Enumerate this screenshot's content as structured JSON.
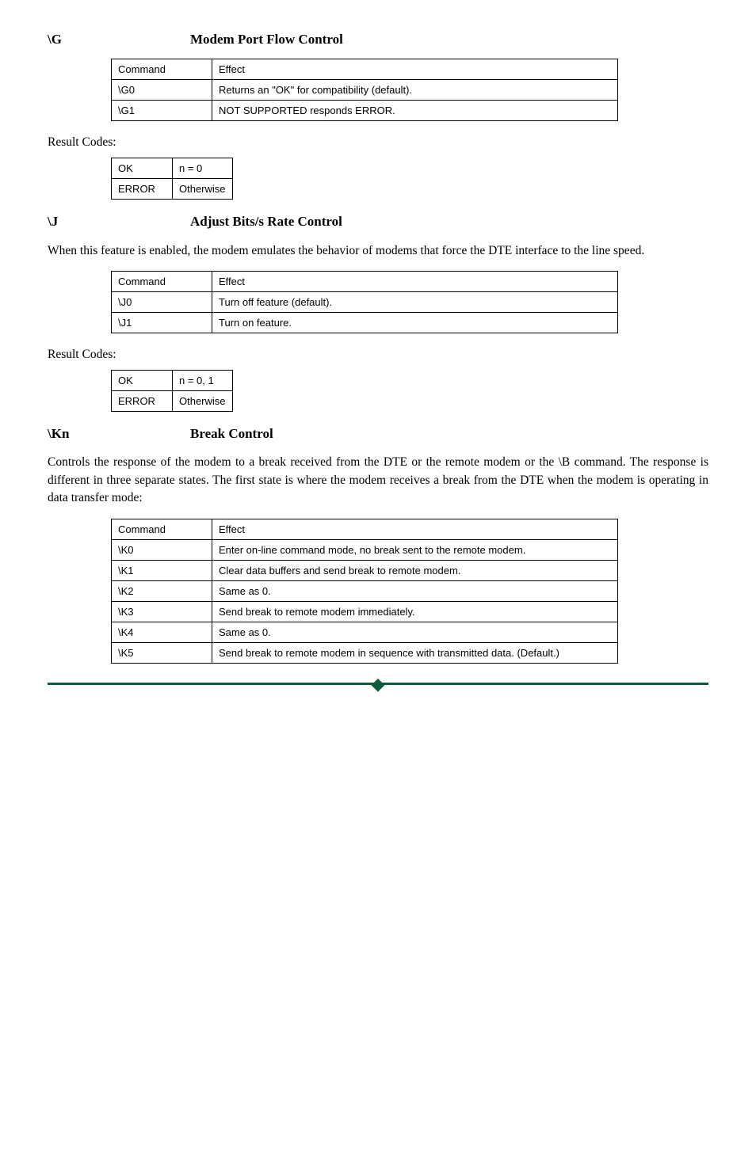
{
  "sections": {
    "g": {
      "key": "\\G",
      "title": "Modem Port Flow Control",
      "effect_header": {
        "command": "Command",
        "effect": "Effect"
      },
      "effects": [
        {
          "cmd": "\\G0",
          "eff": "Returns an \"OK\" for compatibility (default)."
        },
        {
          "cmd": "\\G1",
          "eff": "NOT SUPPORTED responds ERROR."
        }
      ],
      "result_label": "Result Codes:",
      "results": [
        {
          "code": "OK",
          "cond": "n = 0"
        },
        {
          "code": "ERROR",
          "cond": "Otherwise"
        }
      ]
    },
    "j": {
      "key": "\\J",
      "title": "Adjust Bits/s Rate Control",
      "body": "When this feature is enabled, the modem emulates the behavior of modems that force the DTE interface to the line speed.",
      "effect_header": {
        "command": "Command",
        "effect": "Effect"
      },
      "effects": [
        {
          "cmd": "\\J0",
          "eff": "Turn off feature (default)."
        },
        {
          "cmd": "\\J1",
          "eff": "Turn on feature."
        }
      ],
      "result_label": "Result Codes:",
      "results": [
        {
          "code": "OK",
          "cond": "n = 0, 1"
        },
        {
          "code": "ERROR",
          "cond": "Otherwise"
        }
      ]
    },
    "k": {
      "key": "\\Kn",
      "title": "Break Control",
      "body": "Controls the response of the modem to a break received from the DTE or the remote modem or the \\B command. The response is different in three separate states. The first state is where the modem receives a break from the DTE when the modem is operating in data transfer mode:",
      "effect_header": {
        "command": "Command",
        "effect": "Effect"
      },
      "effects": [
        {
          "cmd": "\\K0",
          "eff": "Enter on-line command mode, no break sent to the remote modem."
        },
        {
          "cmd": "\\K1",
          "eff": "Clear data buffers and send break to remote modem."
        },
        {
          "cmd": "\\K2",
          "eff": "Same as 0."
        },
        {
          "cmd": "\\K3",
          "eff": "Send break to remote modem immediately."
        },
        {
          "cmd": "\\K4",
          "eff": "Same as 0."
        },
        {
          "cmd": "\\K5",
          "eff": "Send break to remote modem in sequence with transmitted data. (Default.)"
        }
      ]
    }
  }
}
